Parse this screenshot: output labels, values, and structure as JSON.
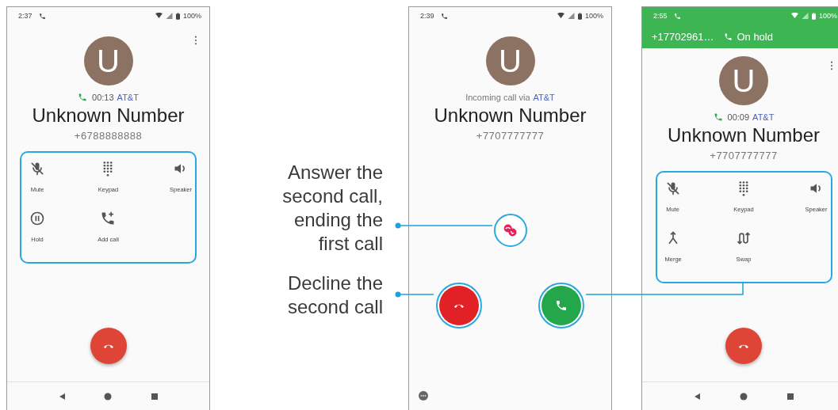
{
  "phones": [
    {
      "kind": "in_call",
      "time": "2:37",
      "battery": "100%",
      "avatar_letter": "U",
      "call_info": {
        "kind": "active",
        "text": "00:13",
        "carrier": "AT&T"
      },
      "name": "Unknown Number",
      "number": "+6788888888",
      "controls": [
        {
          "kind": "mute",
          "label": "Mute"
        },
        {
          "kind": "keypad",
          "label": "Keypad"
        },
        {
          "kind": "speaker",
          "label": "Speaker"
        },
        {
          "kind": "hold",
          "label": "Hold"
        },
        {
          "kind": "add_call",
          "label": "Add call"
        }
      ]
    },
    {
      "kind": "incoming",
      "time": "2:39",
      "battery": "100%",
      "avatar_letter": "U",
      "call_info": {
        "kind": "incoming",
        "text": "Incoming call via",
        "carrier": "AT&T"
      },
      "name": "Unknown Number",
      "number": "+7707777777"
    },
    {
      "kind": "in_call",
      "time": "2:55",
      "battery": "100%",
      "hold_banner": {
        "number": "+17702961…",
        "label": "On hold"
      },
      "avatar_letter": "U",
      "call_info": {
        "kind": "active",
        "text": "00:09",
        "carrier": "AT&T"
      },
      "name": "Unknown Number",
      "number": "+7707777777",
      "controls": [
        {
          "kind": "mute",
          "label": "Mute"
        },
        {
          "kind": "keypad",
          "label": "Keypad"
        },
        {
          "kind": "speaker",
          "label": "Speaker"
        },
        {
          "kind": "merge",
          "label": "Merge"
        },
        {
          "kind": "swap",
          "label": "Swap"
        }
      ]
    }
  ],
  "callouts": [
    {
      "text": "Answer the\nsecond call,\nending the\nfirst call"
    },
    {
      "text": "Decline the\nsecond call"
    }
  ]
}
